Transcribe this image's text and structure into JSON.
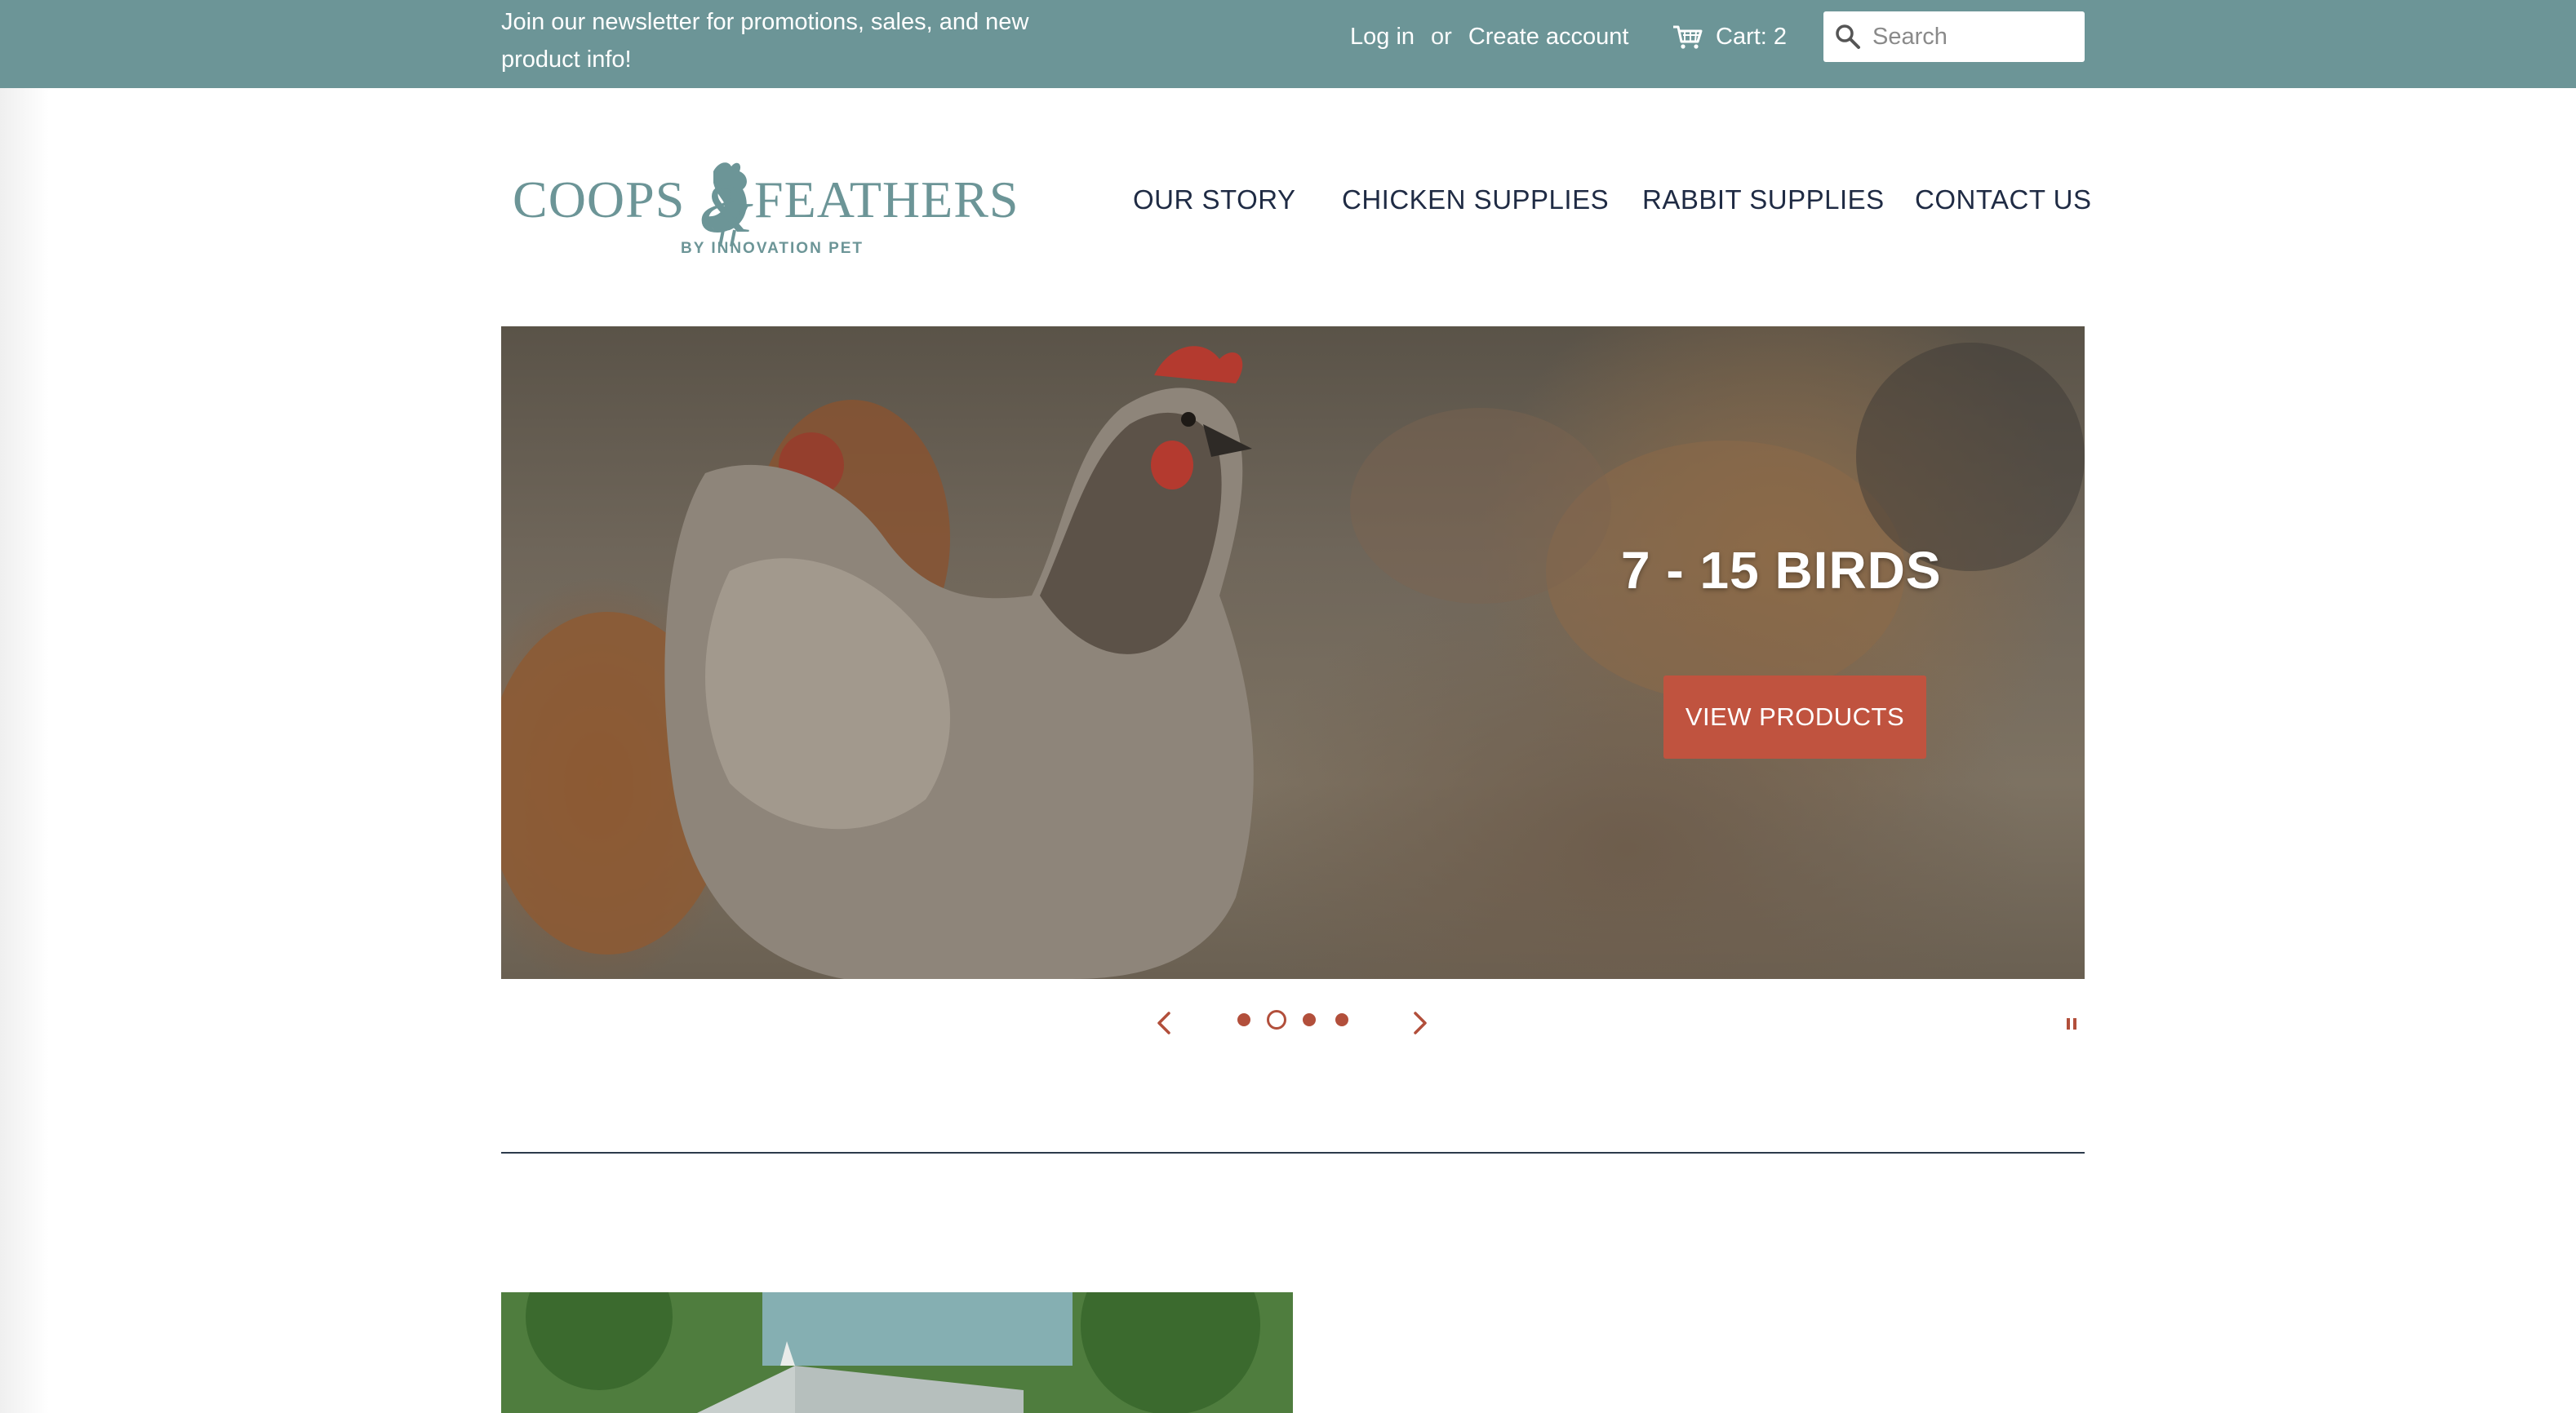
{
  "announcement": {
    "newsletter_text": "Join our newsletter for promotions, sales, and new product info!"
  },
  "account": {
    "login_label": "Log in",
    "or_label": "or",
    "create_label": "Create account"
  },
  "cart": {
    "label": "Cart: 2",
    "icon": "cart-icon"
  },
  "search": {
    "placeholder": "Search",
    "icon": "search-icon"
  },
  "logo": {
    "brand_left": "COOPS",
    "ampersand": "&",
    "brand_right": "FEATHERS",
    "tagline": "BY INNOVATION PET"
  },
  "nav": {
    "items": [
      {
        "label": "OUR STORY"
      },
      {
        "label": "CHICKEN SUPPLIES"
      },
      {
        "label": "RABBIT SUPPLIES"
      },
      {
        "label": "CONTACT US"
      }
    ]
  },
  "hero": {
    "title": "7 - 15 BIRDS",
    "button_label": "VIEW PRODUCTS",
    "slide_count": 4,
    "active_slide": 2
  },
  "colors": {
    "topbar": "#6c9597",
    "accent": "#c0533f",
    "nav_text": "#1f2b44",
    "logo": "#6c9597"
  }
}
